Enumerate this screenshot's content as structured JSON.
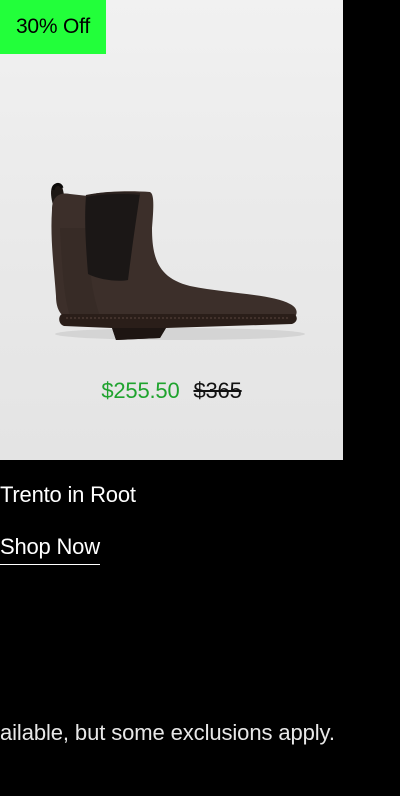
{
  "promo": {
    "badge": "30% Off"
  },
  "product": {
    "image_icon": "chelsea-boot-image",
    "sale_price": "$255.50",
    "original_price": "$365",
    "name": "Trento in Root",
    "cta_label": "Shop Now"
  },
  "footer": {
    "note": "ailable, but some exclusions apply."
  },
  "colors": {
    "badge_bg": "#22ff3a",
    "sale_price": "#1fa32e",
    "page_bg": "#000000",
    "card_bg": "#eeeeee"
  }
}
